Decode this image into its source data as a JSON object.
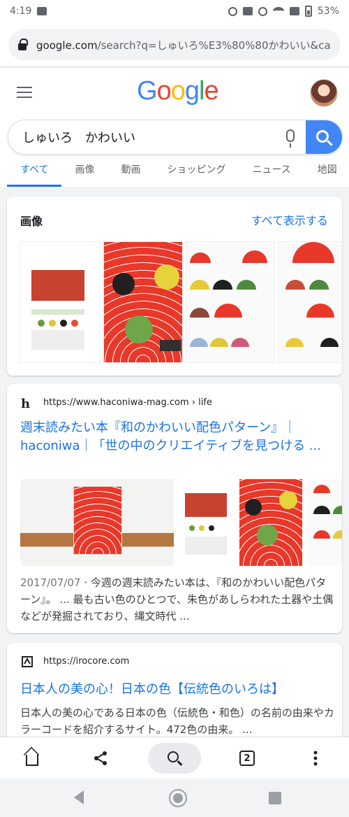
{
  "status_bar": {
    "time": "4:19",
    "battery": "53%"
  },
  "browser": {
    "url_host": "google.com",
    "url_path": "/search?q=しゅいろ%E3%80%80かわいい&ca"
  },
  "google": {
    "logo_letters": [
      "G",
      "o",
      "o",
      "g",
      "l",
      "e"
    ],
    "search_value": "しゅいろ　かわいい",
    "tabs": [
      "すべて",
      "画像",
      "動画",
      "ショッピング",
      "ニュース",
      "地図"
    ]
  },
  "images_section": {
    "title": "画像",
    "see_all": "すべて表示する"
  },
  "result1": {
    "favicon": "h",
    "url": "https://www.haconiwa-mag.com › life",
    "title": "週末読みたい本『和のかわいい配色パターン』｜haconiwa｜「世の中のクリエイティブを見つける ...",
    "date": "2017/07/07",
    "snippet": " · 今週の週末読みたい本は、『和のかわいい配色パターン』。 ... 最も古い色のひとつで、朱色があしらわれた土器や土偶などが発掘されており、縄文時代 ..."
  },
  "result2": {
    "url": "https://irocore.com",
    "title": "日本人の美の心！日本の色【伝統色のいろは】",
    "snippet": "日本人の美の心である日本の色（伝統色・和色）の名前の由来やカラーコードを紹介するサイト。472色の由来。 ..."
  },
  "toolbar": {
    "tab_count": "2"
  },
  "colors": {
    "accent": "#1a73e8",
    "search_button": "#4285f4",
    "vermilion": "#e8382a"
  }
}
